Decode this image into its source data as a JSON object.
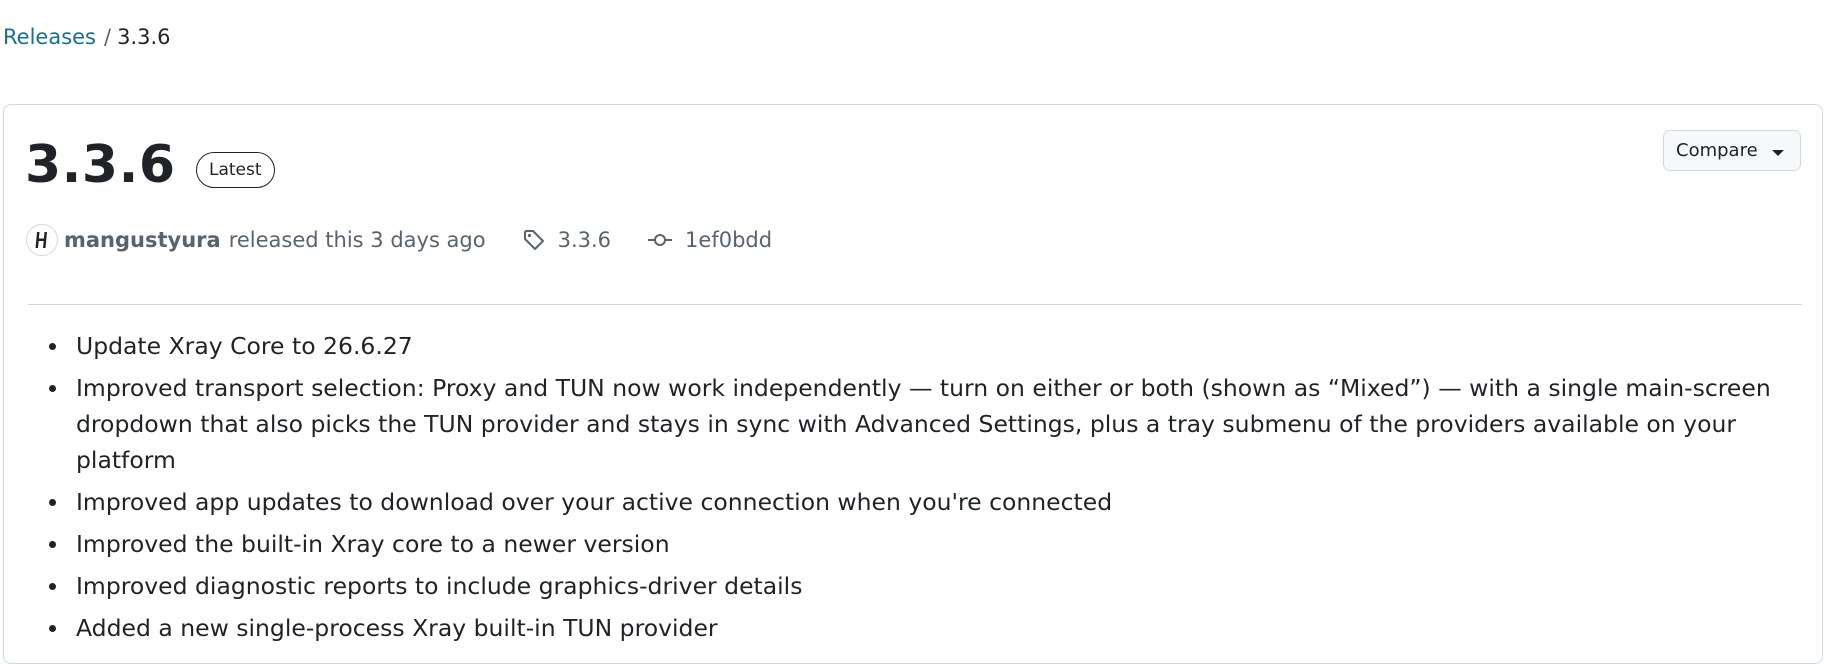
{
  "breadcrumb": {
    "parent": "Releases",
    "separator": "/",
    "current": "3.3.6"
  },
  "release": {
    "title": "3.3.6",
    "badge": "Latest",
    "compare_label": "Compare",
    "author": "mangustyura",
    "released_text": "released this 3 days ago",
    "tag": "3.3.6",
    "commit": "1ef0bdd"
  },
  "notes": [
    "Update Xray Core to 26.6.27",
    "Improved transport selection: Proxy and TUN now work independently — turn on either or both (shown as “Mixed”) — with a single main-screen dropdown that also picks the TUN provider and stays in sync with Advanced Settings, plus a tray submenu of the providers available on your platform",
    "Improved app updates to download over your active connection when you're connected",
    "Improved the built-in Xray core to a newer version",
    "Improved diagnostic reports to include graphics-driver details",
    "Added a new single-process Xray built-in TUN provider"
  ],
  "colors": {
    "link": "#1a6e8e",
    "muted": "#59636e",
    "border": "#d1d9e0",
    "text": "#1f2328"
  },
  "icons": {
    "avatar": "avatar-logo",
    "tag": "tag-icon",
    "commit": "git-commit-icon",
    "caret": "triangle-down-icon"
  }
}
